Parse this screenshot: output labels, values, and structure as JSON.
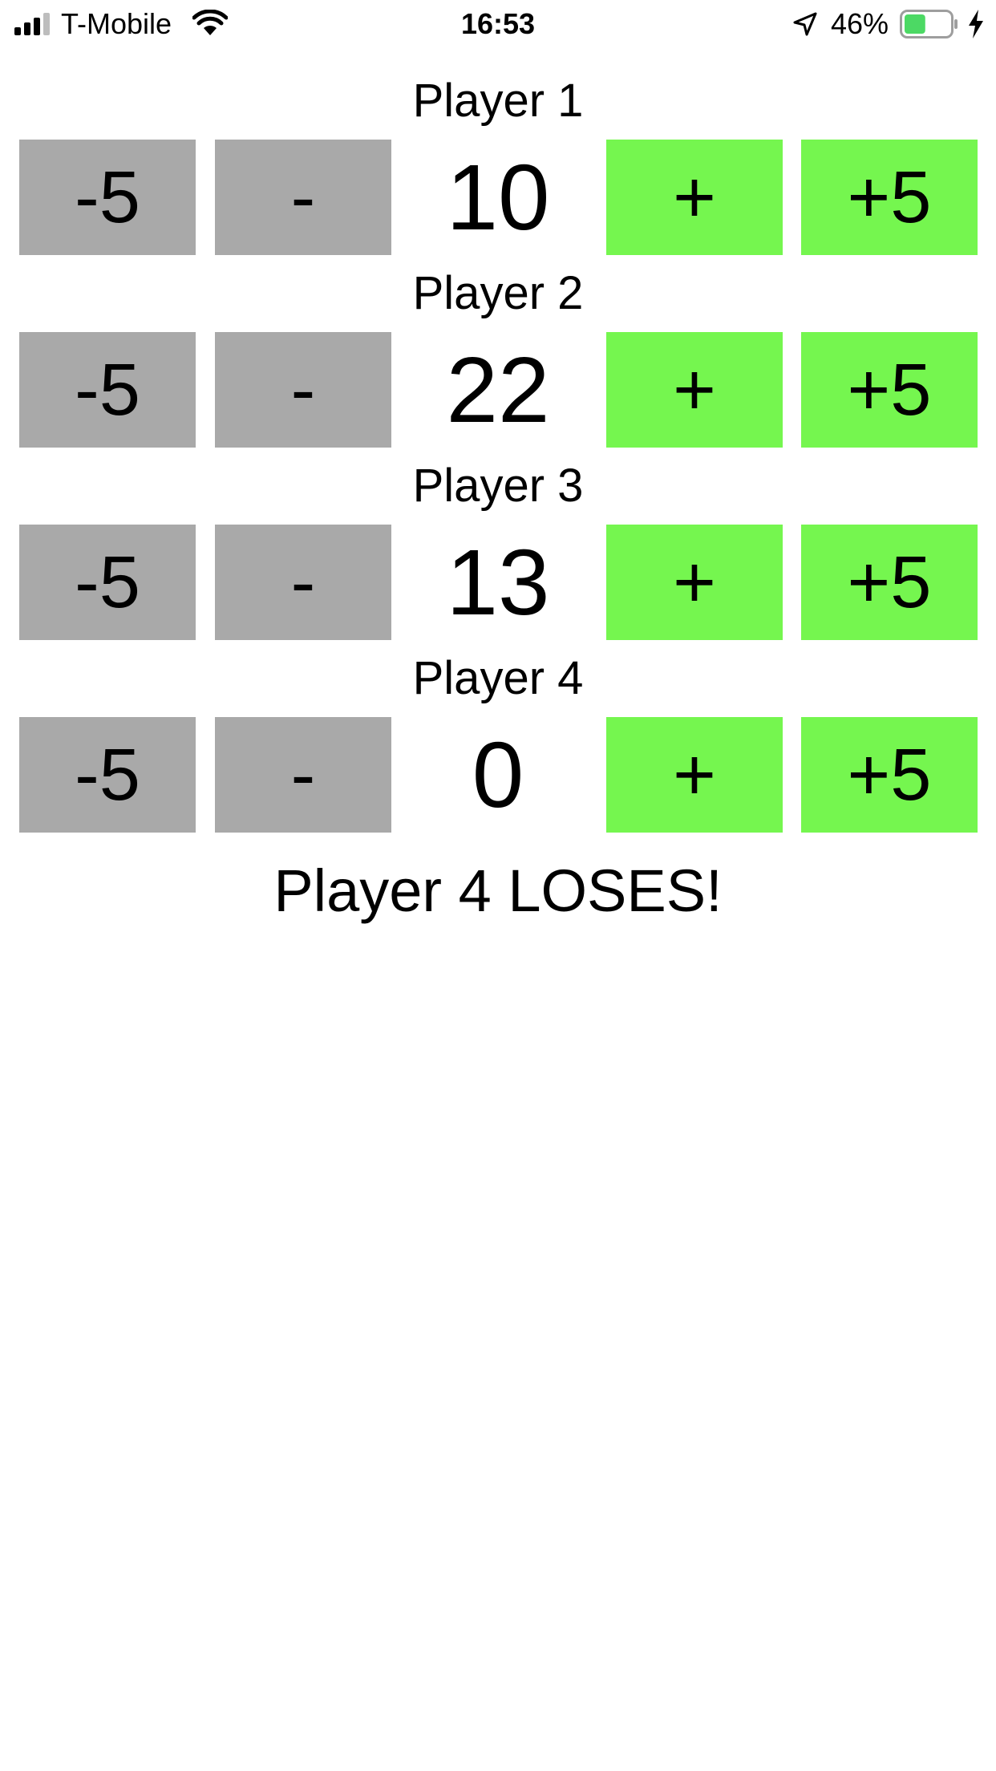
{
  "status_bar": {
    "carrier": "T-Mobile",
    "time": "16:53",
    "battery_percent": "46%",
    "battery_level": 0.46,
    "icons": [
      "signal-icon",
      "wifi-icon",
      "location-icon",
      "battery-icon",
      "charging-icon"
    ]
  },
  "buttons": {
    "minus5": "-5",
    "minus1": "-",
    "plus1": "+",
    "plus5": "+5"
  },
  "players": [
    {
      "label": "Player 1",
      "score": "10"
    },
    {
      "label": "Player 2",
      "score": "22"
    },
    {
      "label": "Player 3",
      "score": "13"
    },
    {
      "label": "Player 4",
      "score": "0"
    }
  ],
  "result": "Player 4 LOSES!",
  "colors": {
    "decrement_button": "#a9a9a9",
    "increment_button": "#75f64f",
    "battery_fill": "#4cd964"
  }
}
